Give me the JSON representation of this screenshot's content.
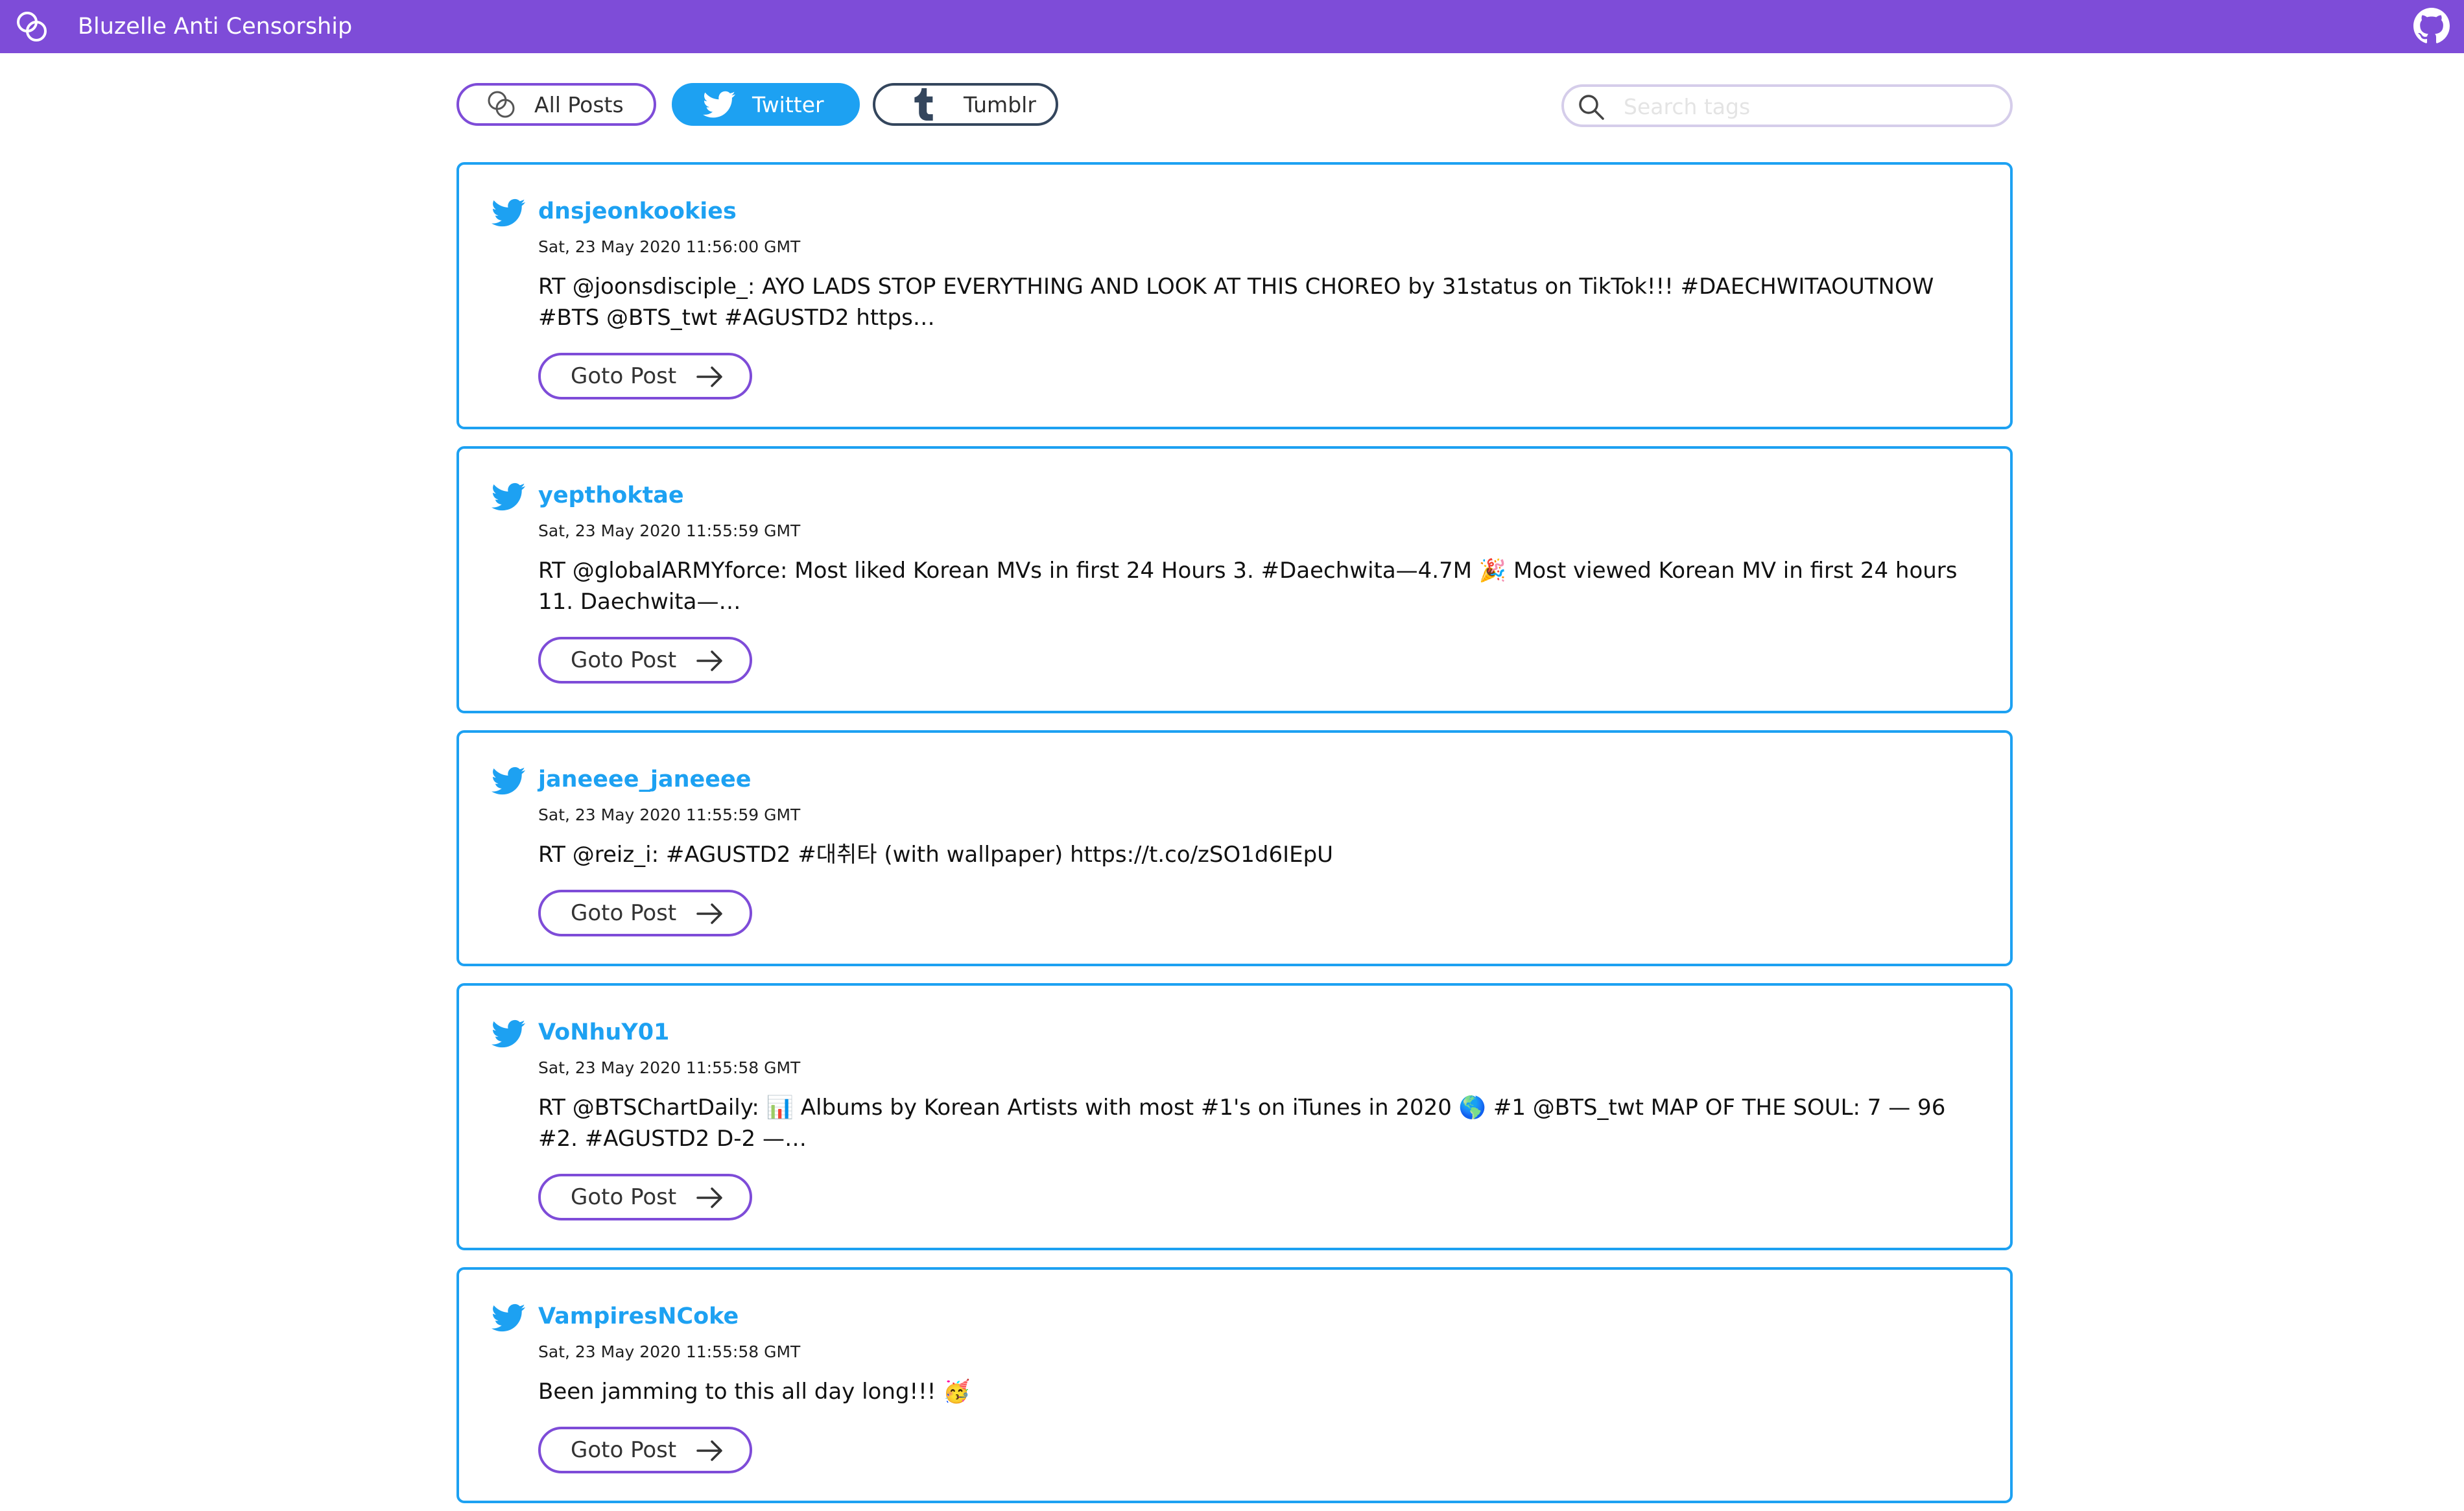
{
  "app": {
    "title": "Bluzelle Anti Censorship"
  },
  "filters": {
    "all": "All Posts",
    "twitter": "Twitter",
    "tumblr": "Tumblr",
    "active": "twitter"
  },
  "search": {
    "placeholder": "Search tags",
    "value": ""
  },
  "colors": {
    "brand": "#7e4cd8",
    "twitter": "#1da1f2",
    "tumblr": "#34465d"
  },
  "posts": [
    {
      "user": "dnsjeonkookies",
      "date": "Sat, 23 May 2020 11:56:00 GMT",
      "text": "RT @joonsdisciple_: AYO LADS STOP EVERYTHING AND LOOK AT THIS CHOREO by 31status on TikTok!!! #DAECHWITAOUTNOW #BTS @BTS_twt #AGUSTD2 https…",
      "button": "Goto Post"
    },
    {
      "user": "yepthoktae",
      "date": "Sat, 23 May 2020 11:55:59 GMT",
      "text": "RT @globalARMYforce: Most liked Korean MVs in first 24 Hours 3. #Daechwita—4.7M 🎉 Most viewed Korean MV in first 24 hours 11. Daechwita—…",
      "button": "Goto Post"
    },
    {
      "user": "janeeee_janeeee",
      "date": "Sat, 23 May 2020 11:55:59 GMT",
      "text": "RT @reiz_i: #AGUSTD2 #대취타 (with wallpaper) https://t.co/zSO1d6IEpU",
      "button": "Goto Post"
    },
    {
      "user": "VoNhuY01",
      "date": "Sat, 23 May 2020 11:55:58 GMT",
      "text": "RT @BTSChartDaily: 📊 Albums by Korean Artists with most #1's on iTunes in 2020 🌎 #1 @BTS_twt MAP OF THE SOUL: 7 — 96 #2. #AGUSTD2 D-2 —…",
      "button": "Goto Post"
    },
    {
      "user": "VampiresNCoke",
      "date": "Sat, 23 May 2020 11:55:58 GMT",
      "text": "Been jamming to this all day long!!! 🥳",
      "button": "Goto Post"
    }
  ]
}
